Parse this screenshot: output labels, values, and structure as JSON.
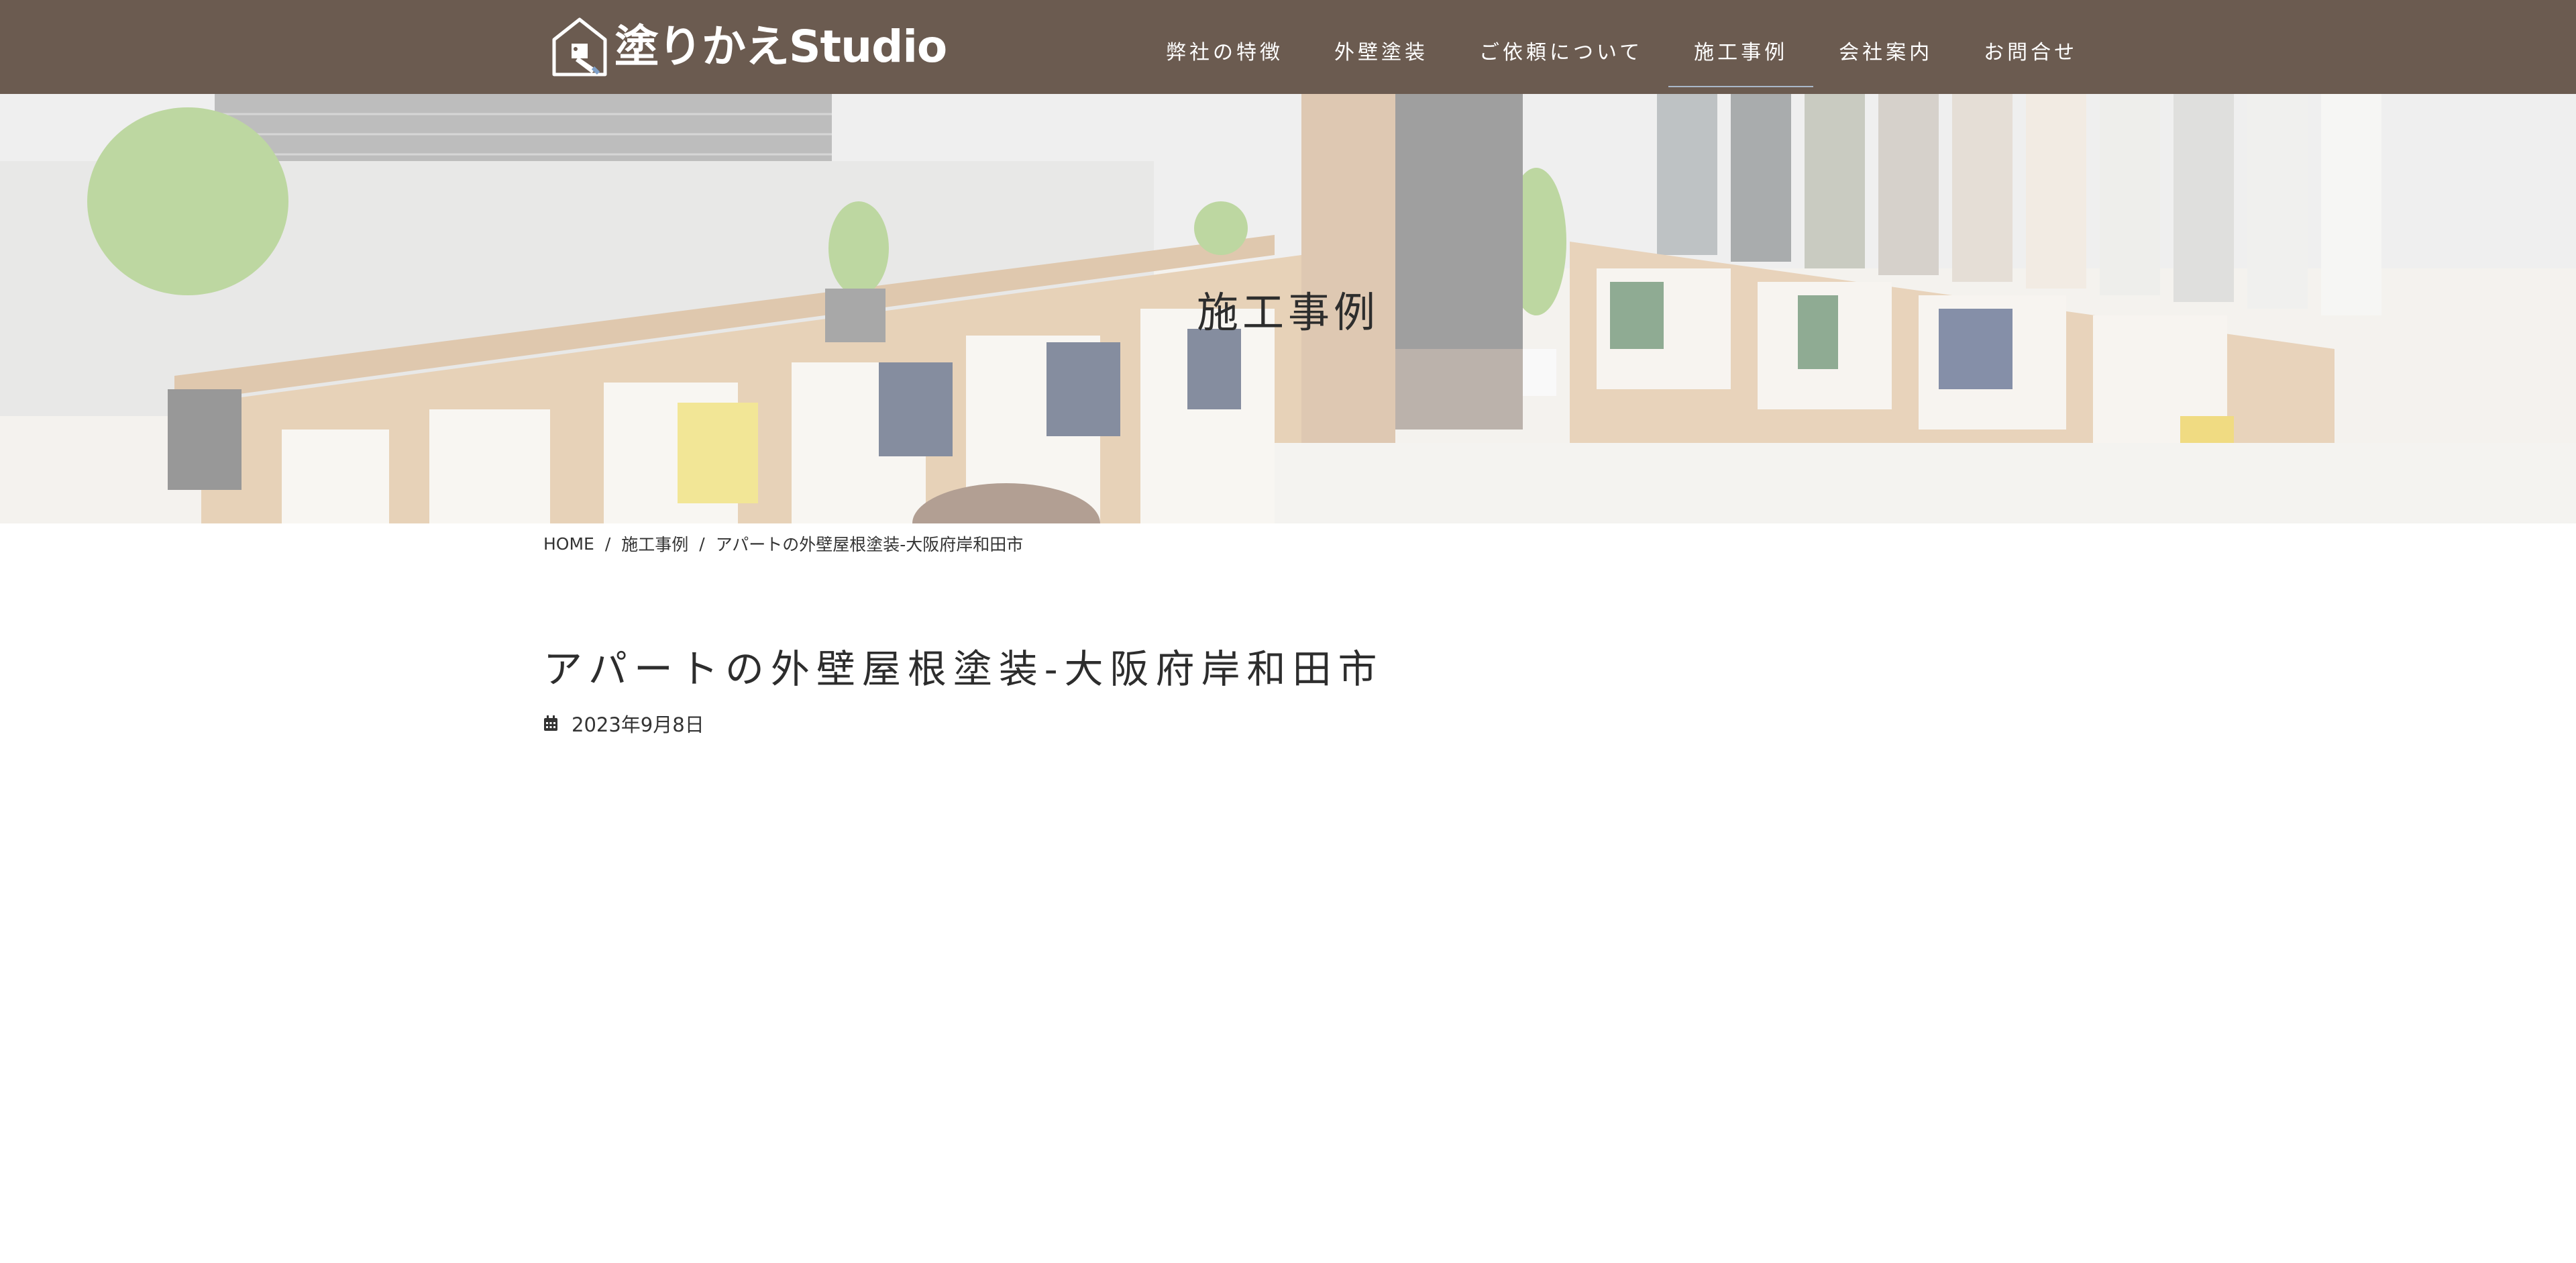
{
  "site": {
    "logo_text": "塗りかえStudio",
    "brand_color": "#6b5b50"
  },
  "nav": {
    "items": [
      {
        "label": "弊社の特徴",
        "active": false
      },
      {
        "label": "外壁塗装",
        "active": false
      },
      {
        "label": "ご依頼について",
        "active": false
      },
      {
        "label": "施工事例",
        "active": true
      },
      {
        "label": "会社案内",
        "active": false
      },
      {
        "label": "お問合せ",
        "active": false
      }
    ]
  },
  "hero": {
    "title": "施工事例"
  },
  "breadcrumb": {
    "home": "HOME",
    "category": "施工事例",
    "current": "アパートの外壁屋根塗装-大阪府岸和田市"
  },
  "post": {
    "title": "アパートの外壁屋根塗装-大阪府岸和田市",
    "date": "2023年9月8日",
    "date_icon": "calendar-icon"
  }
}
